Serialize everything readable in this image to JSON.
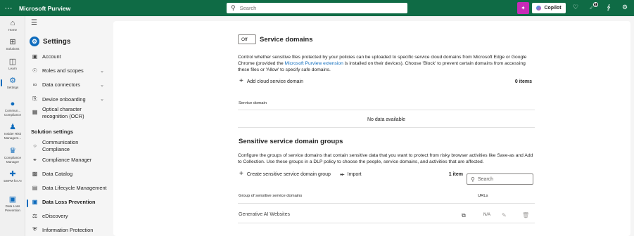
{
  "topbar": {
    "app_name": "Microsoft Purview",
    "search_placeholder": "Search",
    "copilot_label": "Copilot",
    "notification_count": "1"
  },
  "rail": [
    {
      "label": "Home",
      "icon": "home-icon"
    },
    {
      "label": "Solutions",
      "icon": "solutions-icon"
    },
    {
      "label": "Learn",
      "icon": "learn-icon"
    },
    {
      "label": "Settings",
      "icon": "settings-icon",
      "active": true
    },
    {
      "label": "Commun... Compliance",
      "icon": "communication-compliance-icon"
    },
    {
      "label": "Insider Risk Managem...",
      "icon": "insider-risk-icon"
    },
    {
      "label": "Compliance Manager",
      "icon": "compliance-manager-icon"
    },
    {
      "label": "DSPM for AI",
      "icon": "dspm-icon"
    },
    {
      "label": "Data Loss Prevention",
      "icon": "dlp-icon"
    }
  ],
  "nav": {
    "title": "Settings",
    "items": [
      {
        "label": "Account",
        "icon": "account-icon"
      },
      {
        "label": "Roles and scopes",
        "icon": "roles-icon",
        "expandable": true
      },
      {
        "label": "Data connectors",
        "icon": "connectors-icon",
        "expandable": true
      },
      {
        "label": "Device onboarding",
        "icon": "device-icon",
        "expandable": true
      },
      {
        "label": "Optical character recognition (OCR)",
        "icon": "ocr-icon"
      }
    ],
    "section_label": "Solution settings",
    "solution_items": [
      {
        "label": "Communication Compliance",
        "icon": "communication-compliance-icon"
      },
      {
        "label": "Compliance Manager",
        "icon": "compliance-manager-icon"
      },
      {
        "label": "Data Catalog",
        "icon": "data-catalog-icon"
      },
      {
        "label": "Data Lifecycle Management",
        "icon": "lifecycle-icon"
      },
      {
        "label": "Data Loss Prevention",
        "icon": "dlp-icon",
        "active": true
      },
      {
        "label": "eDiscovery",
        "icon": "ediscovery-icon"
      },
      {
        "label": "Information Protection",
        "icon": "info-protection-icon"
      }
    ]
  },
  "service_domains": {
    "toggle_label": "Off",
    "title": "Service domains",
    "desc_before_link": "Control whether sensitive files protected by your policies can be uploaded to specific service cloud domains from Microsoft Edge or Google Chrome (provided the ",
    "desc_link": "Microsoft Purview extension",
    "desc_after_link": " is installed on their devices). Choose 'Block' to prevent certain domains from accessing these files or 'Allow' to specify safe domains.",
    "add_label": "Add cloud service domain",
    "count": "0 items",
    "column_header": "Service domain",
    "empty_text": "No data available"
  },
  "groups": {
    "title": "Sensitive service domain groups",
    "description": "Configure the groups of service domains that contain sensitive data that you want to protect from risky browser activities like Save-as and Add to Collection. Use these groups in a DLP policy to choose the people, service domains, and activities that are affected.",
    "create_label": "Create sensitive service domain group",
    "import_label": "Import",
    "count": "1 item",
    "search_placeholder": "Search",
    "col_group": "Group of sensitive service domains",
    "col_urls": "URLs",
    "rows": [
      {
        "name": "Generative AI Websites",
        "urls": "N/A"
      }
    ]
  }
}
